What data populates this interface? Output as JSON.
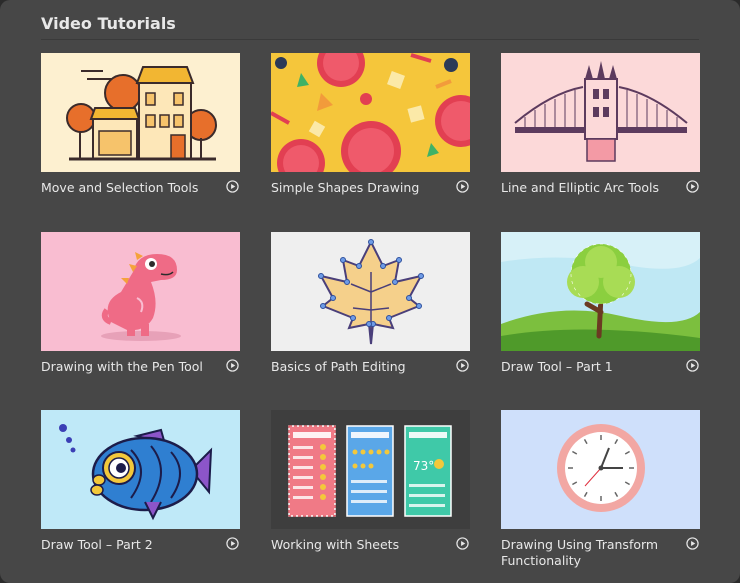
{
  "section": {
    "title": "Video Tutorials"
  },
  "tutorials": [
    {
      "label": "Move and Selection Tools",
      "thumbnail": "houses-illustration"
    },
    {
      "label": "Simple Shapes Drawing",
      "thumbnail": "pizza-shapes-pattern"
    },
    {
      "label": "Line and Elliptic Arc Tools",
      "thumbnail": "tower-bridge-illustration"
    },
    {
      "label": "Drawing with the Pen Tool",
      "thumbnail": "dinosaur-illustration"
    },
    {
      "label": "Basics of Path Editing",
      "thumbnail": "maple-leaf-paths"
    },
    {
      "label": "Draw Tool – Part 1",
      "thumbnail": "tree-landscape"
    },
    {
      "label": "Draw Tool – Part 2",
      "thumbnail": "fish-illustration"
    },
    {
      "label": "Working with Sheets",
      "thumbnail": "weather-app-screens"
    },
    {
      "label": "Drawing Using Transform Functionality",
      "thumbnail": "wall-clock"
    }
  ],
  "colors": {
    "panel": "#474747",
    "text": "#e8e8e8",
    "play_icon": "#e8e8e8"
  }
}
